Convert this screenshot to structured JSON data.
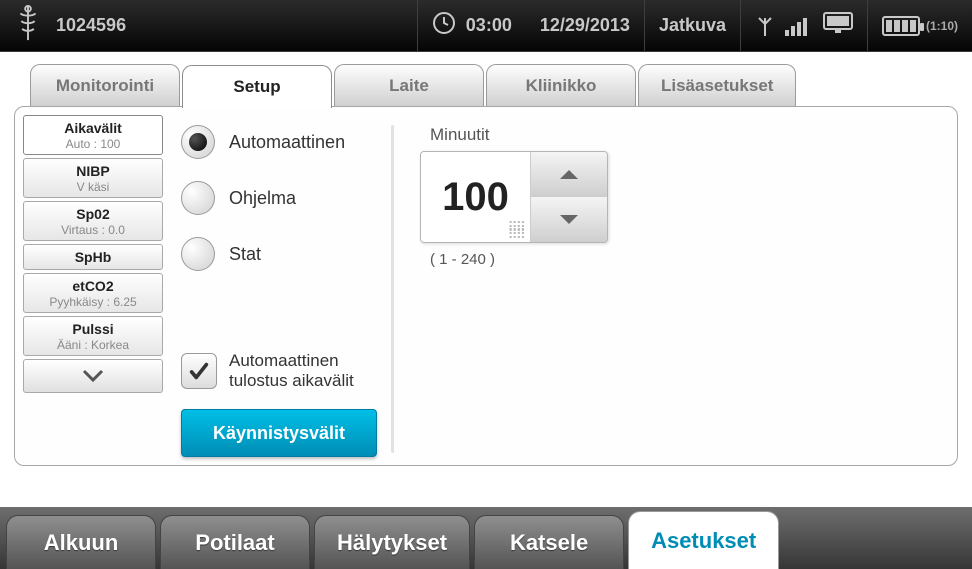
{
  "topbar": {
    "device_id": "1024596",
    "time": "03:00",
    "date": "12/29/2013",
    "mode": "Jatkuva",
    "battery_ratio": "(1:10)"
  },
  "tabs": {
    "monitoring": "Monitorointi",
    "setup": "Setup",
    "device": "Laite",
    "clinician": "Kliinikko",
    "advanced": "Lisäasetukset"
  },
  "sidebar": {
    "items": [
      {
        "title": "Aikavälit",
        "sub": "Auto : 100"
      },
      {
        "title": "NIBP",
        "sub": "V käsi"
      },
      {
        "title": "Sp02",
        "sub": "Virtaus : 0.0"
      },
      {
        "title": "SpHb",
        "sub": " "
      },
      {
        "title": "etCO2",
        "sub": "Pyyhkäisy : 6.25"
      },
      {
        "title": "Pulssi",
        "sub": "Ääni : Korkea"
      }
    ]
  },
  "intervals": {
    "radio": {
      "automatic": "Automaattinen",
      "program": "Ohjelma",
      "stat": "Stat"
    },
    "auto_print_line1": "Automaattinen",
    "auto_print_line2": "tulostus aikavälit",
    "start_btn": "Käynnistysvälit",
    "field_label": "Minuutit",
    "value": "100",
    "range": "( 1 - 240 )"
  },
  "bottom": {
    "home": "Alkuun",
    "patients": "Potilaat",
    "alarms": "Hälytykset",
    "review": "Katsele",
    "settings": "Asetukset"
  }
}
